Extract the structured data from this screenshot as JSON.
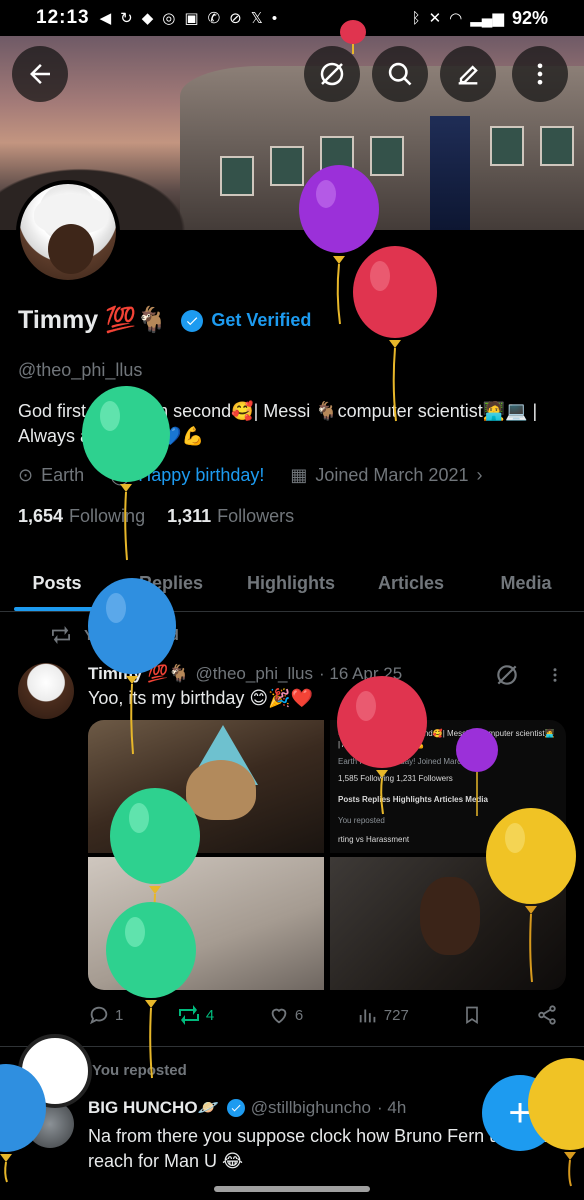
{
  "status_bar": {
    "time": "12:13",
    "battery": "92%"
  },
  "profile": {
    "name": "Timmy 💯🐐",
    "get_verified": "Get Verified",
    "handle": "@theo_phi_llus",
    "bio": "God first 🙏 | mom second🥰| Messi 🐐computer scientist🧑‍💻💻 | Always a blue fan💙💪",
    "location": "Earth",
    "birthday_link": "Happy birthday!",
    "joined": "Joined March 2021",
    "following_count": "1,654",
    "following_label": "Following",
    "followers_count": "1,311",
    "followers_label": "Followers"
  },
  "tabs": [
    "Posts",
    "Replies",
    "Highlights",
    "Articles",
    "Media"
  ],
  "active_tab": "Posts",
  "post1": {
    "repost_label": "You reposted",
    "author": "Timmy 💯🐐",
    "handle": "@theo_phi_llus",
    "time": "· 16 Apr 25",
    "text": "Yoo, its my birthday 😊🎉❤️",
    "replies": "1",
    "reposts": "4",
    "likes": "6",
    "views": "727"
  },
  "post1_media_text": {
    "bio_snippet": "God first 🙏 | mom second🥰| Messi 🐐computer scientist🧑‍💻 | Always a blue fan💙💪",
    "meta_snippet": "Earth   Happy birthday!   Joined March 2021",
    "counts_snippet": "1,585 Following   1,231 Followers",
    "tabs_snippet": "Posts   Replies   Highlights   Articles   Media",
    "repost_snippet": "You reposted",
    "text_snippet": "rting vs Harassment"
  },
  "post2": {
    "repost_label": "You reposted",
    "author": "BIG HUNCHO🪐",
    "handle": "@stillbighuncho",
    "time": "· 4h",
    "text": "Na from there you suppose clock how Bruno Fern useless reach for Man U 😂"
  },
  "colors": {
    "accent": "#1d9bf0",
    "muted": "#71767b",
    "repost_green": "#00ba7c",
    "balloon_purple": "#9b30d9",
    "balloon_red": "#e0344f",
    "balloon_green": "#2ed18f",
    "balloon_blue": "#2f8fe0",
    "balloon_yellow": "#f0c325"
  }
}
